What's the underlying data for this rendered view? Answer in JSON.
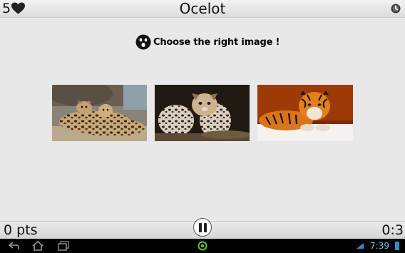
{
  "header": {
    "lives": "5",
    "title": "Ocelot"
  },
  "prompt": {
    "text": "Choose the right image !"
  },
  "choices": [
    {
      "subject": "two ocelots lying together"
    },
    {
      "subject": "ocelot sitting"
    },
    {
      "subject": "tiger lying on snow"
    }
  ],
  "footer": {
    "points": "0 pts",
    "timer": "0:3"
  },
  "system_bar": {
    "clock": "7:39"
  },
  "colors": {
    "heart": "#222222",
    "clock": "#6fc3e8",
    "battery": "#2a8fd0",
    "home_indicator": "#5cc42b"
  }
}
